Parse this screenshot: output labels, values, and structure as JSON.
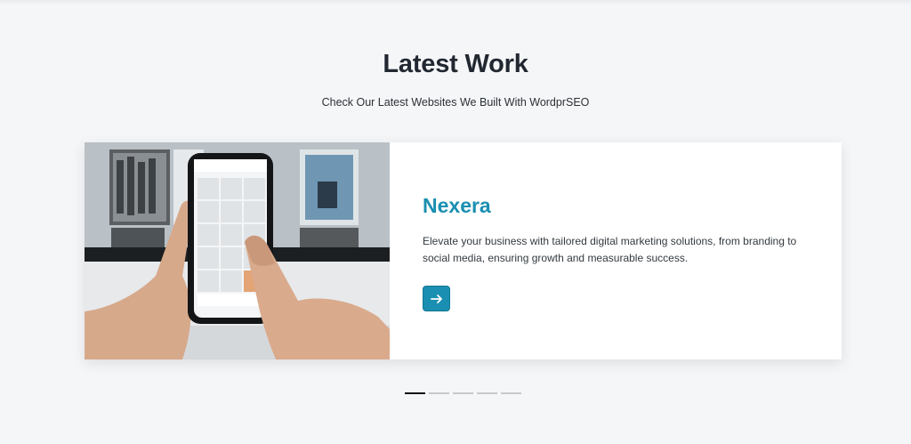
{
  "section": {
    "title": "Latest Work",
    "subtitle": "Check Our Latest Websites We Built With WordprSEO"
  },
  "project": {
    "name": "Nexera",
    "description": "Elevate your business with tailored digital marketing solutions, from branding to social media, ensuring growth and measurable success.",
    "image_alt": "Hands holding a smartphone showing a photo grid",
    "button_icon": "arrow-right-icon"
  },
  "carousel": {
    "slide_count": 5,
    "active_index": 0
  },
  "colors": {
    "accent": "#1a8fb1",
    "heading": "#222831",
    "background": "#f5f6f8"
  }
}
